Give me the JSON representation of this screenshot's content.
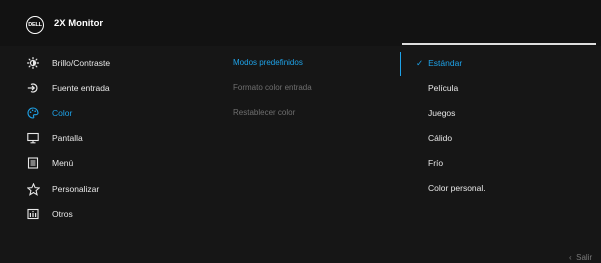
{
  "header": {
    "logo_text": "DELL",
    "title": "2X Monitor"
  },
  "menu": {
    "items": [
      {
        "label": "Brillo/Contraste",
        "icon": "brightness-icon",
        "active": false
      },
      {
        "label": "Fuente entrada",
        "icon": "input-source-icon",
        "active": false
      },
      {
        "label": "Color",
        "icon": "color-palette-icon",
        "active": true
      },
      {
        "label": "Pantalla",
        "icon": "display-icon",
        "active": false
      },
      {
        "label": "Menú",
        "icon": "menu-icon",
        "active": false
      },
      {
        "label": "Personalizar",
        "icon": "star-icon",
        "active": false
      },
      {
        "label": "Otros",
        "icon": "info-icon",
        "active": false
      }
    ]
  },
  "submenu": {
    "items": [
      {
        "label": "Modos predefinidos",
        "active": true
      },
      {
        "label": "Formato color entrada",
        "active": false
      },
      {
        "label": "Restablecer color",
        "active": false
      }
    ]
  },
  "options": {
    "items": [
      {
        "label": "Estándar",
        "selected": true
      },
      {
        "label": "Película",
        "selected": false
      },
      {
        "label": "Juegos",
        "selected": false
      },
      {
        "label": "Cálido",
        "selected": false
      },
      {
        "label": "Frío",
        "selected": false
      },
      {
        "label": "Color personal.",
        "selected": false
      }
    ]
  },
  "footer": {
    "exit_label": "Salir"
  },
  "colors": {
    "accent": "#1ea2e8",
    "background": "#161616",
    "header_bg": "#121212"
  }
}
